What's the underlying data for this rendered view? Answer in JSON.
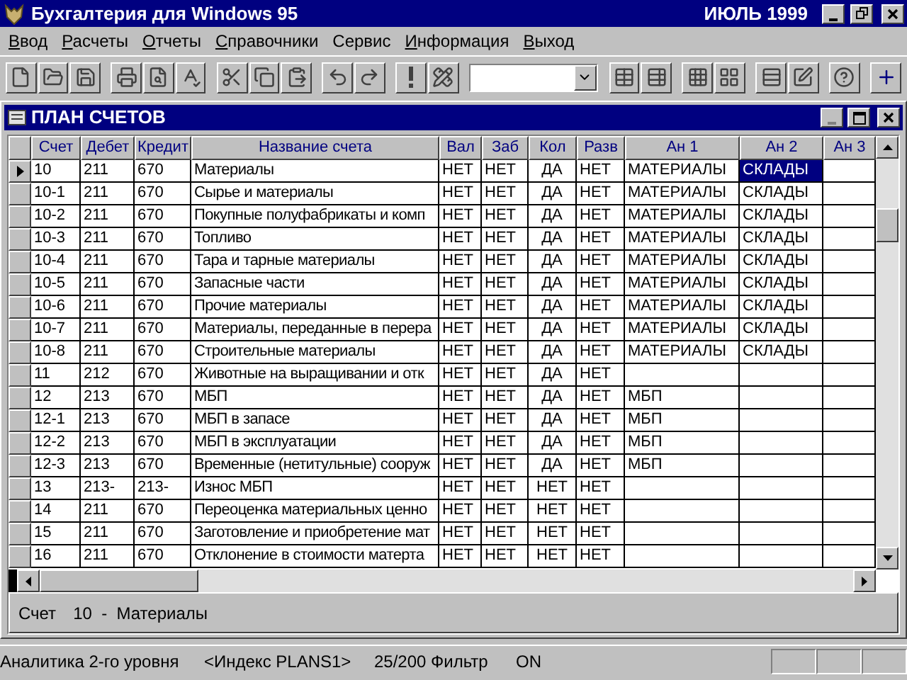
{
  "window": {
    "title": "Бухгалтерия для Windows 95",
    "period": "ИЮЛЬ 1999"
  },
  "menu": [
    {
      "label": "Ввод",
      "hotkey_underlined": true
    },
    {
      "label": "Расчеты",
      "hotkey_underlined": true
    },
    {
      "label": "Отчеты",
      "hotkey_underlined": true
    },
    {
      "label": "Справочники",
      "hotkey_underlined": true
    },
    {
      "label": "Сервис",
      "hotkey_underlined": false
    },
    {
      "label": "Информация",
      "hotkey_underlined": true
    },
    {
      "label": "Выход",
      "hotkey_underlined": true
    }
  ],
  "child_window": {
    "title": "ПЛАН СЧЕТОВ"
  },
  "table": {
    "columns": [
      "Счет",
      "Дебет",
      "Кредит",
      "Название счета",
      "Вал",
      "Заб",
      "Кол",
      "Разв",
      "Ан 1",
      "Ан 2",
      "Ан 3"
    ],
    "rows": [
      {
        "selected": true,
        "cells": [
          "10",
          "211",
          "670",
          "Материалы",
          "НЕТ",
          "НЕТ",
          "ДА",
          "НЕТ",
          "МАТЕРИАЛЫ",
          {
            "text": "СКЛАДЫ",
            "selected": true
          }
        ]
      },
      {
        "selected": false,
        "cells": [
          "10-1",
          "211",
          "670",
          "Сырье и материалы",
          "НЕТ",
          "НЕТ",
          "ДА",
          "НЕТ",
          "МАТЕРИАЛЫ",
          "СКЛАДЫ"
        ]
      },
      {
        "selected": false,
        "cells": [
          "10-2",
          "211",
          "670",
          "Покупные полуфабрикаты и комп",
          "НЕТ",
          "НЕТ",
          "ДА",
          "НЕТ",
          "МАТЕРИАЛЫ",
          "СКЛАДЫ"
        ]
      },
      {
        "selected": false,
        "cells": [
          "10-3",
          "211",
          "670",
          "Топливо",
          "НЕТ",
          "НЕТ",
          "ДА",
          "НЕТ",
          "МАТЕРИАЛЫ",
          "СКЛАДЫ"
        ]
      },
      {
        "selected": false,
        "cells": [
          "10-4",
          "211",
          "670",
          "Тара и тарные материалы",
          "НЕТ",
          "НЕТ",
          "ДА",
          "НЕТ",
          "МАТЕРИАЛЫ",
          "СКЛАДЫ"
        ]
      },
      {
        "selected": false,
        "cells": [
          "10-5",
          "211",
          "670",
          "Запасные части",
          "НЕТ",
          "НЕТ",
          "ДА",
          "НЕТ",
          "МАТЕРИАЛЫ",
          "СКЛАДЫ"
        ]
      },
      {
        "selected": false,
        "cells": [
          "10-6",
          "211",
          "670",
          "Прочие материалы",
          "НЕТ",
          "НЕТ",
          "ДА",
          "НЕТ",
          "МАТЕРИАЛЫ",
          "СКЛАДЫ"
        ]
      },
      {
        "selected": false,
        "cells": [
          "10-7",
          "211",
          "670",
          "Материалы, переданные в перера",
          "НЕТ",
          "НЕТ",
          "ДА",
          "НЕТ",
          "МАТЕРИАЛЫ",
          "СКЛАДЫ"
        ]
      },
      {
        "selected": false,
        "cells": [
          "10-8",
          "211",
          "670",
          "Строительные материалы",
          "НЕТ",
          "НЕТ",
          "ДА",
          "НЕТ",
          "МАТЕРИАЛЫ",
          "СКЛАДЫ"
        ]
      },
      {
        "selected": false,
        "cells": [
          "11",
          "212",
          "670",
          "Животные на выращивании и отк",
          "НЕТ",
          "НЕТ",
          "ДА",
          "НЕТ"
        ]
      },
      {
        "selected": false,
        "cells": [
          "12",
          "213",
          "670",
          "МБП",
          "НЕТ",
          "НЕТ",
          "ДА",
          "НЕТ",
          "МБП"
        ]
      },
      {
        "selected": false,
        "cells": [
          "12-1",
          "213",
          "670",
          "МБП в запасе",
          "НЕТ",
          "НЕТ",
          "ДА",
          "НЕТ",
          "МБП"
        ]
      },
      {
        "selected": false,
        "cells": [
          "12-2",
          "213",
          "670",
          "МБП в эксплуатации",
          "НЕТ",
          "НЕТ",
          "ДА",
          "НЕТ",
          "МБП"
        ]
      },
      {
        "selected": false,
        "cells": [
          "12-3",
          "213",
          "670",
          "Временные (нетитульные) сооруж",
          "НЕТ",
          "НЕТ",
          "ДА",
          "НЕТ",
          "МБП"
        ]
      },
      {
        "selected": false,
        "cells": [
          "13",
          "213-",
          "213-",
          "Износ МБП",
          "НЕТ",
          "НЕТ",
          "НЕТ",
          "НЕТ"
        ]
      },
      {
        "selected": false,
        "cells": [
          "14",
          "211",
          "670",
          "Переоценка материальных ценно",
          "НЕТ",
          "НЕТ",
          "НЕТ",
          "НЕТ"
        ]
      },
      {
        "selected": false,
        "cells": [
          "15",
          "211",
          "670",
          "Заготовление и приобретение мат",
          "НЕТ",
          "НЕТ",
          "НЕТ",
          "НЕТ"
        ]
      },
      {
        "selected": false,
        "cells": [
          "16",
          "211",
          "670",
          "Отклонение в стоимости матерта",
          "НЕТ",
          "НЕТ",
          "НЕТ",
          "НЕТ"
        ]
      }
    ]
  },
  "info": {
    "label": "Счет",
    "value": "10  -  Материалы"
  },
  "status_bar": [
    "Аналитика 2-го уровня",
    "<Индекс PLANS1>",
    "25/200 Фильтр",
    "ON"
  ]
}
